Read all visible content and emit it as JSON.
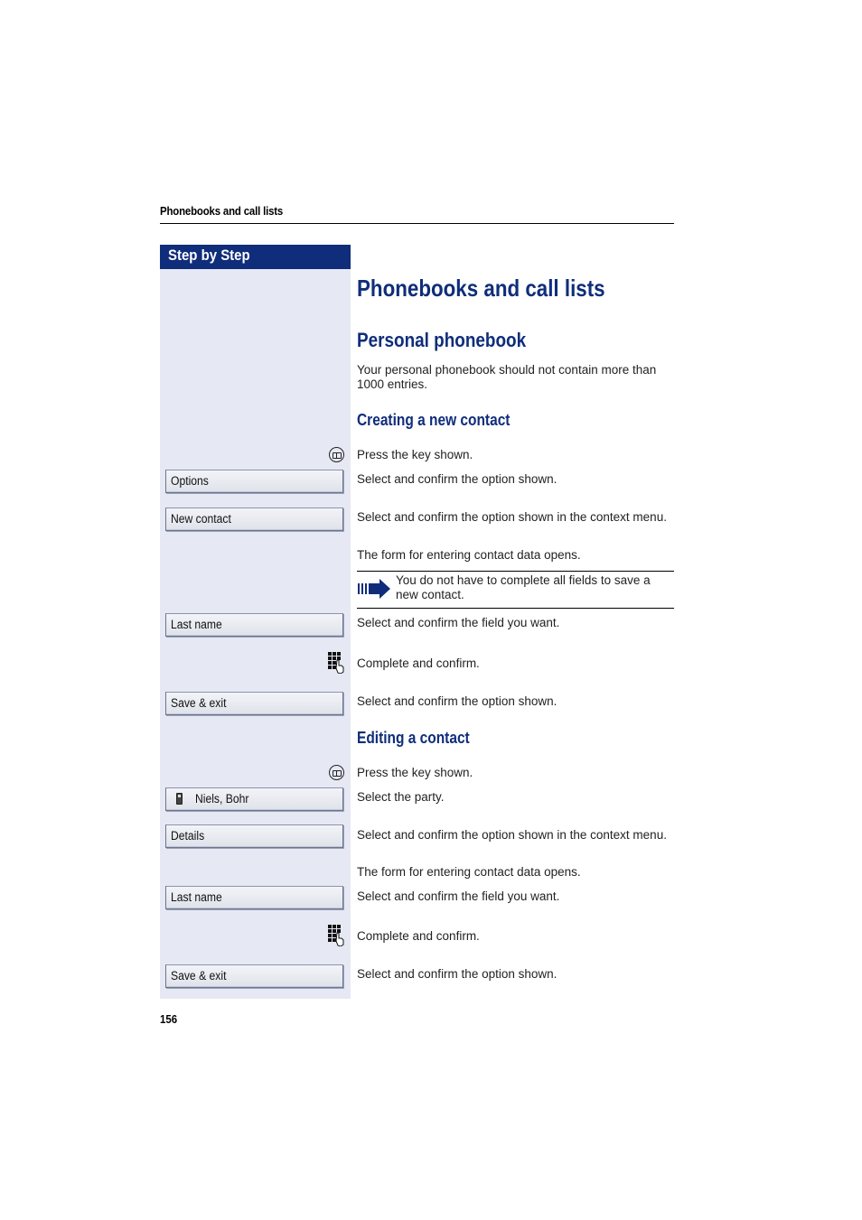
{
  "running_head": "Phonebooks and call lists",
  "sidebar_header": "Step by Step",
  "title": "Phonebooks and call lists",
  "section": {
    "title": "Personal phonebook",
    "intro": "Your personal phonebook should not contain more than 1000 entries."
  },
  "creating": {
    "title": "Creating a new contact",
    "steps": [
      {
        "icon": "phonebook-key-icon",
        "text": "Press the key shown."
      },
      {
        "button": "Options",
        "text": "Select and confirm the option shown."
      },
      {
        "button": "New contact",
        "text": "Select and confirm the option shown in the context menu."
      },
      {
        "text": "The form for entering contact data opens."
      },
      {
        "button": "Last name",
        "text": "Select and confirm the field you want."
      },
      {
        "icon": "keypad-icon",
        "text": "Complete and confirm."
      },
      {
        "button": "Save & exit",
        "text": "Select and confirm the option shown."
      }
    ],
    "note": "You do not have to complete all fields to save a new contact."
  },
  "editing": {
    "title": "Editing a contact",
    "steps": [
      {
        "icon": "phonebook-key-icon",
        "text": "Press the key shown."
      },
      {
        "button": "Niels, Bohr",
        "text": "Select the party."
      },
      {
        "button": "Details",
        "text": "Select and confirm the option shown in the context menu."
      },
      {
        "text": "The form for entering contact data opens."
      },
      {
        "button": "Last name",
        "text": "Select and confirm the field you want."
      },
      {
        "icon": "keypad-icon",
        "text": "Complete and confirm."
      },
      {
        "button": "Save & exit",
        "text": "Select and confirm the option shown."
      }
    ]
  },
  "page_number": "156",
  "colors": {
    "brand": "#0f2d7a",
    "sidebar": "#e6e9f4"
  }
}
